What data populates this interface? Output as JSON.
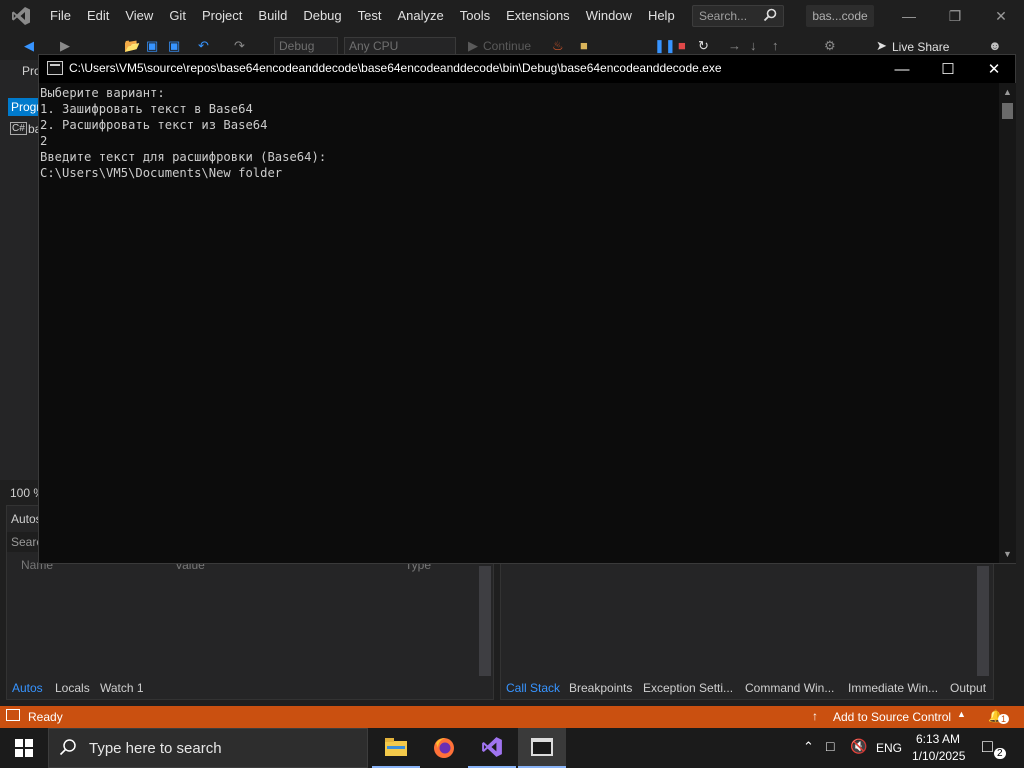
{
  "menubar": {
    "items": [
      "File",
      "Edit",
      "View",
      "Git",
      "Project",
      "Build",
      "Debug",
      "Test",
      "Analyze",
      "Tools",
      "Extensions",
      "Window",
      "Help"
    ],
    "search_placeholder": "Search...",
    "solution_name": "bas...code"
  },
  "toolbar": {
    "config": "Debug",
    "platform": "Any CPU",
    "continue_label": "Continue",
    "liveshare_label": "Live Share"
  },
  "left_panel": {
    "tab_label": "Progr",
    "tab2_label": "Pro",
    "item_label": "ba",
    "zoom": "100 %"
  },
  "autos_pane": {
    "title": "Autos",
    "search_label": "Searc",
    "columns": [
      "Name",
      "Value",
      "Type"
    ],
    "tabs": [
      "Autos",
      "Locals",
      "Watch 1"
    ]
  },
  "callstack_pane": {
    "tabs": [
      "Call Stack",
      "Breakpoints",
      "Exception Setti...",
      "Command Win...",
      "Immediate Win...",
      "Output"
    ]
  },
  "statusbar": {
    "ready": "Ready",
    "source_control": "Add to Source Control",
    "notifications": "1"
  },
  "console": {
    "title": "C:\\Users\\VM5\\source\\repos\\base64encodeanddecode\\base64encodeanddecode\\bin\\Debug\\base64encodeanddecode.exe",
    "lines": [
      "Выберите вариант:",
      "1. Зашифровать текст в Base64",
      "2. Расшифровать текст из Base64",
      "2",
      "Введите текст для расшифровки (Base64):",
      "C:\\Users\\VM5\\Documents\\New folder"
    ]
  },
  "taskbar": {
    "search_placeholder": "Type here to search",
    "language": "ENG",
    "time": "6:13 AM",
    "date": "1/10/2025",
    "notification_count": "2"
  },
  "colors": {
    "statusbar": "#ca5010",
    "accent": "#3794ff",
    "console_bg": "#0c0c0c"
  }
}
